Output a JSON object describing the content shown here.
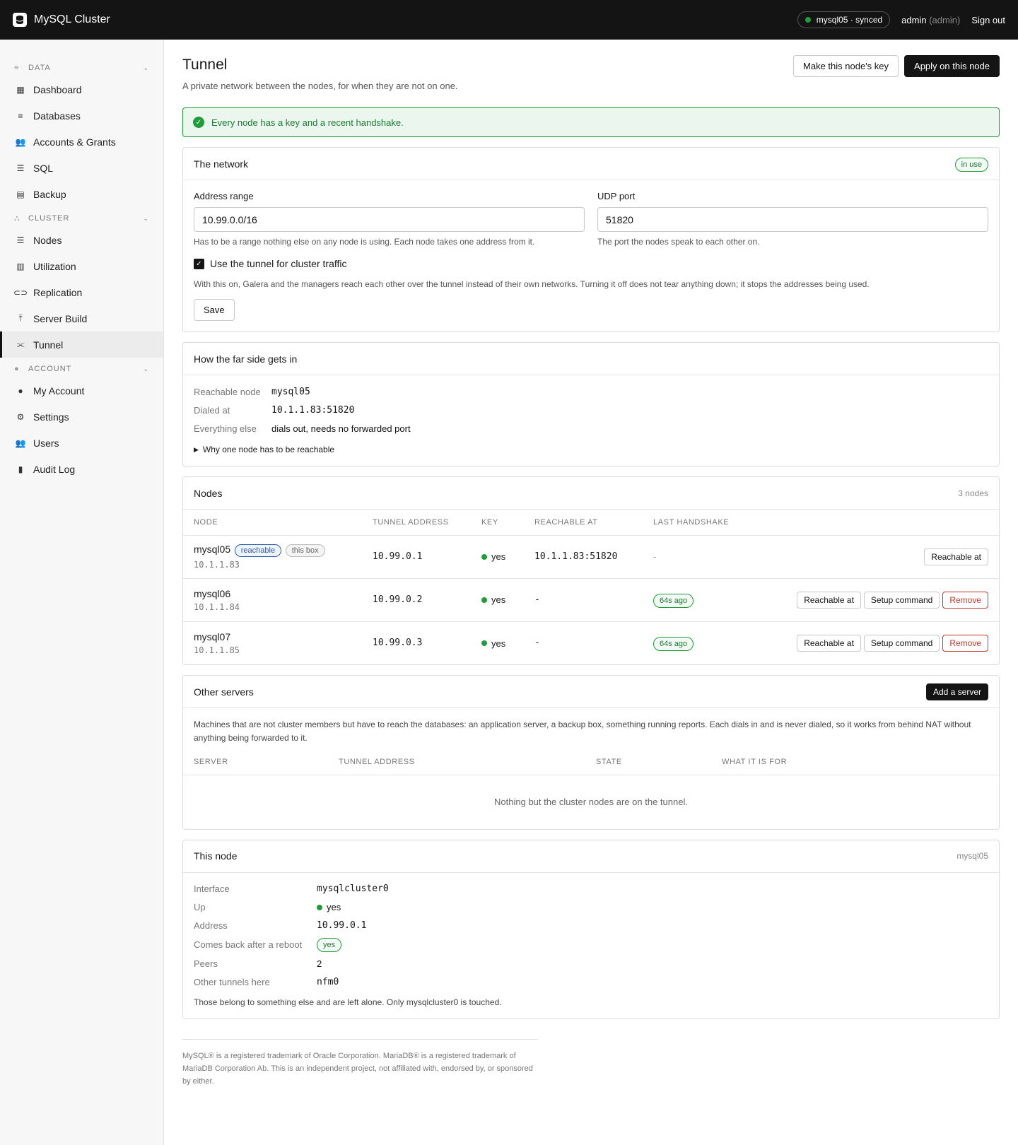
{
  "app": {
    "title": "MySQL Cluster",
    "node_status": "mysql05 · synced",
    "user": "admin",
    "user_role": "(admin)",
    "signout": "Sign out"
  },
  "sidebar": {
    "sections": [
      {
        "label": "DATA",
        "items": [
          "Dashboard",
          "Databases",
          "Accounts & Grants",
          "SQL",
          "Backup"
        ]
      },
      {
        "label": "CLUSTER",
        "items": [
          "Nodes",
          "Utilization",
          "Replication",
          "Server Build",
          "Tunnel"
        ]
      },
      {
        "label": "ACCOUNT",
        "items": [
          "My Account",
          "Settings",
          "Users",
          "Audit Log"
        ]
      }
    ],
    "active": "Tunnel"
  },
  "page": {
    "title": "Tunnel",
    "subtitle": "A private network between the nodes, for when they are not on one.",
    "btn_key": "Make this node's key",
    "btn_apply": "Apply on this node",
    "alert": "Every node has a key and a recent handshake."
  },
  "network": {
    "title": "The network",
    "badge": "in use",
    "range_label": "Address range",
    "range_value": "10.99.0.0/16",
    "range_hint": "Has to be a range nothing else on any node is using. Each node takes one address from it.",
    "port_label": "UDP port",
    "port_value": "51820",
    "port_hint": "The port the nodes speak to each other on.",
    "checkbox_label": "Use the tunnel for cluster traffic",
    "checkbox_hint": "With this on, Galera and the managers reach each other over the tunnel instead of their own networks. Turning it off does not tear anything down; it stops the addresses being used.",
    "save": "Save"
  },
  "far_side": {
    "title": "How the far side gets in",
    "rows": [
      {
        "k": "Reachable node",
        "v": "mysql05"
      },
      {
        "k": "Dialed at",
        "v": "10.1.1.83:51820"
      },
      {
        "k": "Everything else",
        "v": "dials out, needs no forwarded port"
      }
    ],
    "details": "Why one node has to be reachable"
  },
  "nodes": {
    "title": "Nodes",
    "count": "3 nodes",
    "headers": [
      "NODE",
      "TUNNEL ADDRESS",
      "KEY",
      "REACHABLE AT",
      "LAST HANDSHAKE"
    ],
    "rows": [
      {
        "name": "mysql05",
        "ip": "10.1.1.83",
        "badges": [
          "reachable",
          "this box"
        ],
        "addr": "10.99.0.1",
        "key": "yes",
        "reach": "10.1.1.83:51820",
        "hs": "-",
        "actions": [
          "Reachable at"
        ]
      },
      {
        "name": "mysql06",
        "ip": "10.1.1.84",
        "badges": [],
        "addr": "10.99.0.2",
        "key": "yes",
        "reach": "-",
        "hs": "64s ago",
        "actions": [
          "Reachable at",
          "Setup command",
          "Remove"
        ]
      },
      {
        "name": "mysql07",
        "ip": "10.1.1.85",
        "badges": [],
        "addr": "10.99.0.3",
        "key": "yes",
        "reach": "-",
        "hs": "64s ago",
        "actions": [
          "Reachable at",
          "Setup command",
          "Remove"
        ]
      }
    ]
  },
  "other": {
    "title": "Other servers",
    "add": "Add a server",
    "desc": "Machines that are not cluster members but have to reach the databases: an application server, a backup box, something running reports. Each dials in and is never dialed, so it works from behind NAT without anything being forwarded to it.",
    "headers": [
      "SERVER",
      "TUNNEL ADDRESS",
      "STATE",
      "WHAT IT IS FOR"
    ],
    "empty": "Nothing but the cluster nodes are on the tunnel."
  },
  "this_node": {
    "title": "This node",
    "name": "mysql05",
    "interface_k": "Interface",
    "interface_v": "mysqlcluster0",
    "up_k": "Up",
    "up_v": "yes",
    "address_k": "Address",
    "address_v": "10.99.0.1",
    "reboot_k": "Comes back after a reboot",
    "reboot_v": "yes",
    "peers_k": "Peers",
    "peers_v": "2",
    "other_k": "Other tunnels here",
    "other_v": "nfm0",
    "note": "Those belong to something else and are left alone. Only mysqlcluster0 is touched."
  },
  "footer": "MySQL® is a registered trademark of Oracle Corporation. MariaDB® is a registered trademark of MariaDB Corporation Ab. This is an independent project, not affiliated with, endorsed by, or sponsored by either.",
  "colors": {
    "accent_green": "#1f9d3a",
    "danger": "#c0392b",
    "blue": "#2c5ea8",
    "topbar": "#141414"
  }
}
